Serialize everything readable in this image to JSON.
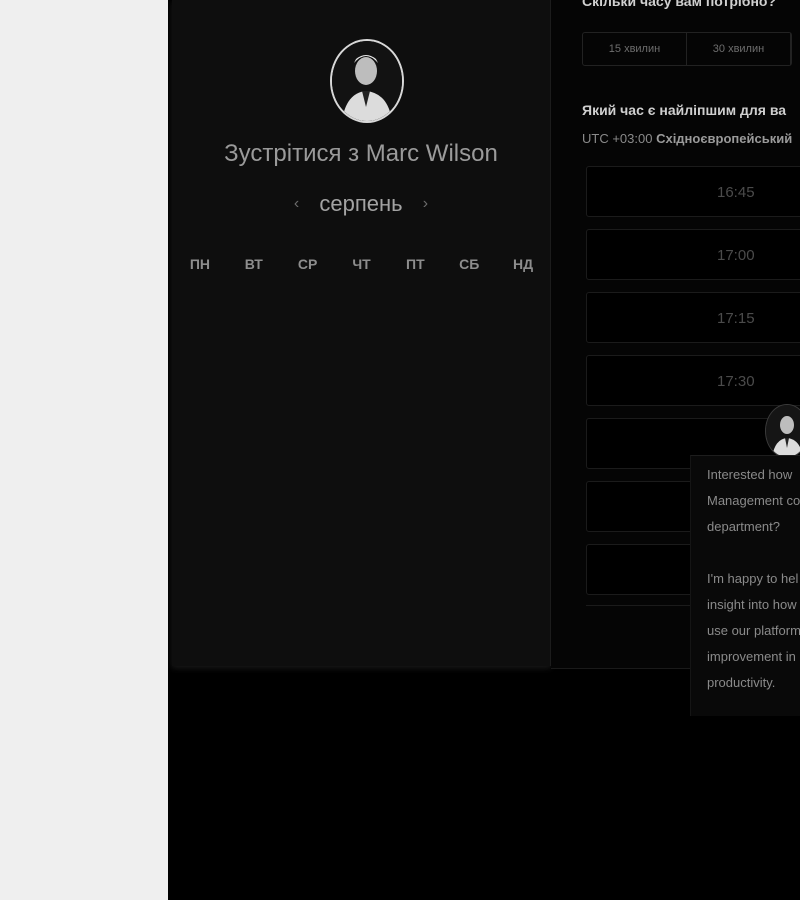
{
  "host": {
    "title": "Зустрітися з Marc Wilson",
    "avatar_icon": "person-portrait-icon"
  },
  "calendar": {
    "month": "серпень",
    "prev_icon": "chevron-left-icon",
    "next_icon": "chevron-right-icon",
    "weekdays": [
      "ПН",
      "ВТ",
      "СР",
      "ЧТ",
      "ПТ",
      "СБ",
      "НД"
    ]
  },
  "duration": {
    "question": "Скільки часу вам потрібно?",
    "options": [
      "15 хвилин",
      "30 хвилин"
    ]
  },
  "time_select": {
    "question": "Який час є найліпшим для ва",
    "timezone_prefix": "UTC +03:00",
    "timezone_name": "Східноєвропейський",
    "slots": [
      "16:45",
      "17:00",
      "17:15",
      "17:30"
    ]
  },
  "chat": {
    "message_1": "Interested how Management co department?",
    "message_2": "I'm happy to hel insight into how use our platform improvement in productivity."
  }
}
